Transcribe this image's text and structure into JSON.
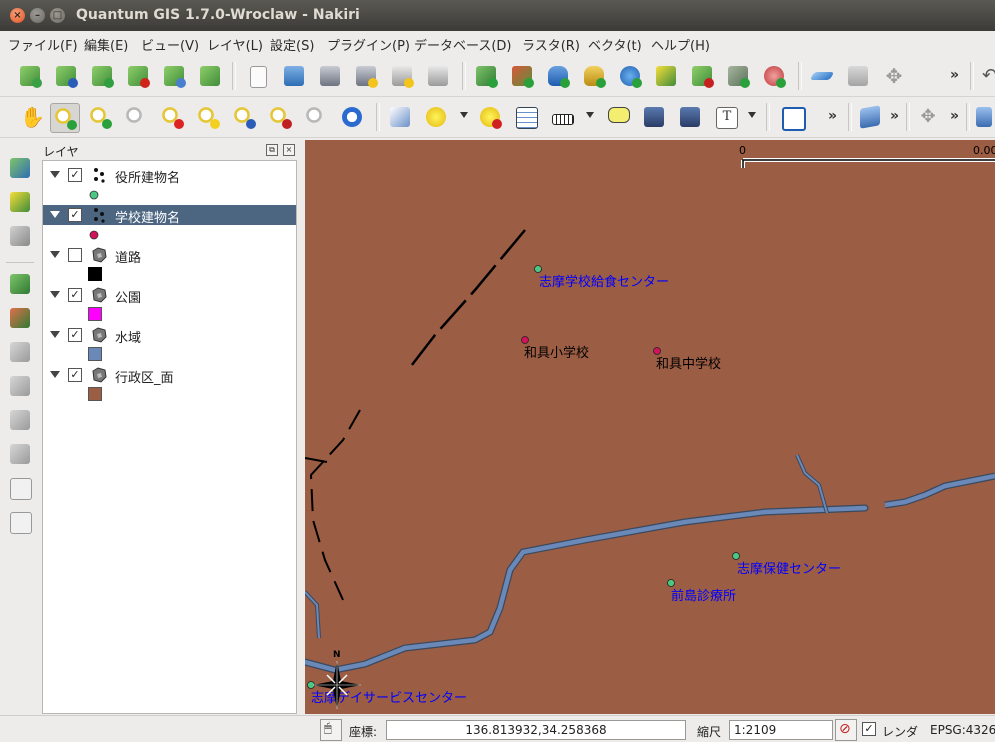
{
  "window": {
    "title": "Quantum GIS 1.7.0-Wroclaw - Nakiri"
  },
  "menubar": {
    "items": [
      "ファイル(F)",
      "編集(E)",
      "ビュー(V)",
      "レイヤ(L)",
      "設定(S)",
      "プラグイン(P)",
      "データベース(D)",
      "ラスタ(R)",
      "ベクタ(t)",
      "ヘルプ(H)"
    ]
  },
  "layers_panel": {
    "title": "レイヤ",
    "layers": [
      {
        "name": "役所建物名",
        "checked": true,
        "type_icon": "point-layer-icon",
        "symbol": "circle",
        "color": "#4cc783"
      },
      {
        "name": "学校建物名",
        "checked": true,
        "type_icon": "point-layer-icon",
        "symbol": "circle",
        "color": "#d0135a",
        "selected": true
      },
      {
        "name": "道路",
        "checked": false,
        "type_icon": "polygon-layer-icon",
        "symbol": "square",
        "color": "#000000"
      },
      {
        "name": "公園",
        "checked": true,
        "type_icon": "polygon-layer-icon",
        "symbol": "square",
        "color": "#ff00ff"
      },
      {
        "name": "水域",
        "checked": true,
        "type_icon": "polygon-layer-icon",
        "symbol": "square",
        "color": "#6a89b8"
      },
      {
        "name": "行政区_面",
        "checked": true,
        "type_icon": "polygon-layer-icon",
        "symbol": "square",
        "color": "#9b5d43"
      }
    ]
  },
  "map": {
    "background_color": "#9b5d43",
    "scalebar": {
      "label_start": "0",
      "label_end": "0.00"
    },
    "north_arrow_label": "N",
    "labels": [
      {
        "text": "志摩学校給食センター",
        "color": "#0000ff",
        "point": "#4cc783"
      },
      {
        "text": "和具小学校",
        "color": "#000000",
        "point": "#d0135a"
      },
      {
        "text": "和具中学校",
        "color": "#000000",
        "point": "#d0135a"
      },
      {
        "text": "志摩保健センター",
        "color": "#0000ff",
        "point": "#4cc783"
      },
      {
        "text": "前島診療所",
        "color": "#0000ff",
        "point": "#4cc783"
      },
      {
        "text": "志摩デイサービスセンター",
        "color": "#0000ff",
        "point": "#4cc783"
      }
    ]
  },
  "statusbar": {
    "coord_label": "座標:",
    "coord_value": "136.813932,34.258368",
    "scale_label": "縮尺",
    "scale_value": "1:2109",
    "render_label": "レンダ",
    "crs": "EPSG:4326"
  }
}
